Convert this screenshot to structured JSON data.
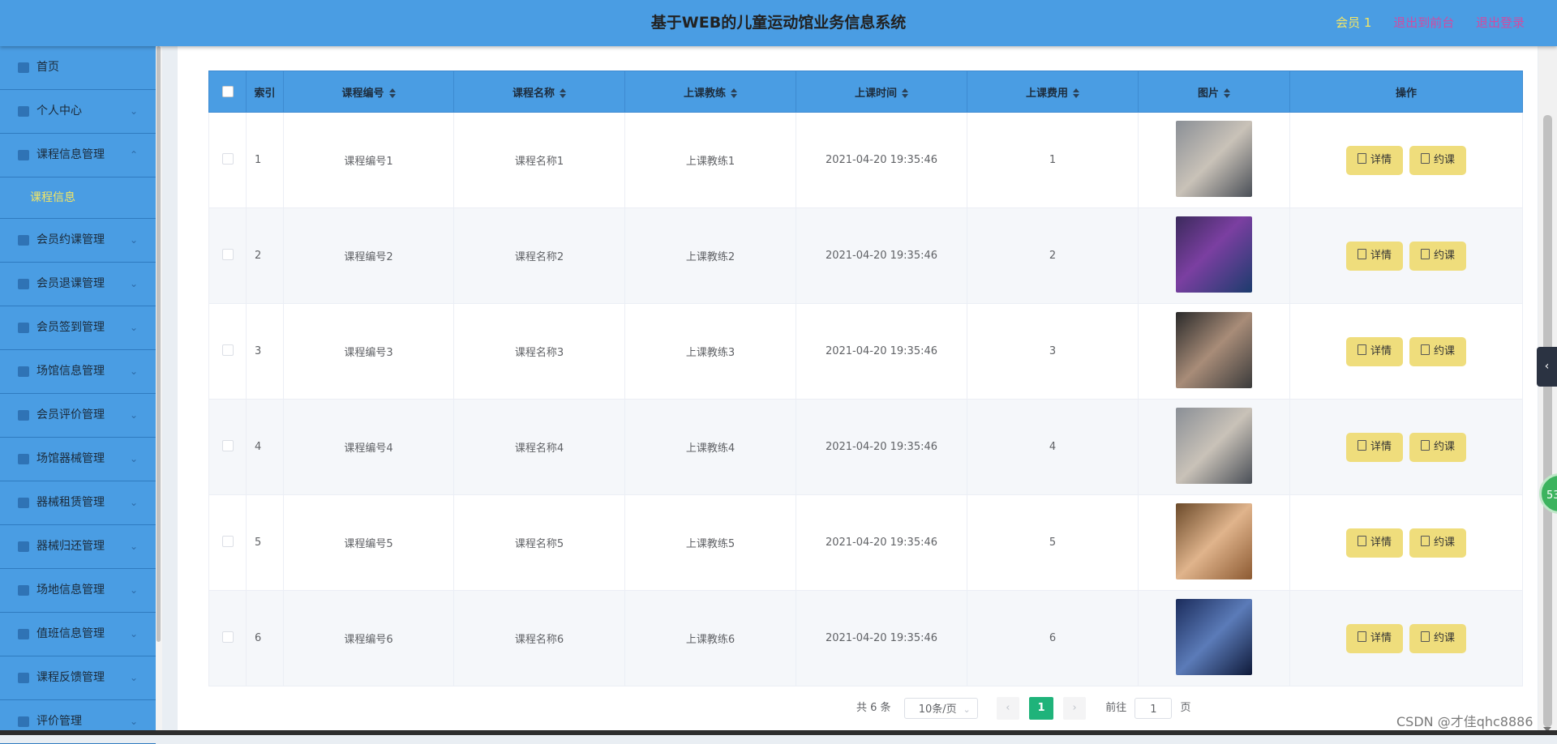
{
  "header": {
    "title": "基于WEB的儿童运动馆业务信息系统",
    "member": "会员 1",
    "back_front": "退出到前台",
    "logout": "退出登录"
  },
  "sidebar": {
    "items": [
      {
        "label": "首页",
        "icon": "home-icon"
      },
      {
        "label": "个人中心",
        "icon": "user-icon"
      },
      {
        "label": "课程信息管理",
        "icon": "course-icon",
        "expanded": true,
        "sub": "课程信息"
      },
      {
        "label": "会员约课管理",
        "icon": "booking-icon"
      },
      {
        "label": "会员退课管理",
        "icon": "flag-icon"
      },
      {
        "label": "会员签到管理",
        "icon": "checkin-icon"
      },
      {
        "label": "场馆信息管理",
        "icon": "venue-icon"
      },
      {
        "label": "会员评价管理",
        "icon": "review-icon"
      },
      {
        "label": "场馆器械管理",
        "icon": "equipment-icon"
      },
      {
        "label": "器械租赁管理",
        "icon": "rent-icon"
      },
      {
        "label": "器械归还管理",
        "icon": "return-icon"
      },
      {
        "label": "场地信息管理",
        "icon": "field-icon"
      },
      {
        "label": "值班信息管理",
        "icon": "duty-icon"
      },
      {
        "label": "课程反馈管理",
        "icon": "feedback-icon"
      },
      {
        "label": "评价管理",
        "icon": "rating-icon"
      }
    ]
  },
  "table": {
    "headers": [
      "索引",
      "课程编号",
      "课程名称",
      "上课教练",
      "上课时间",
      "上课费用",
      "图片",
      "操作"
    ],
    "rows": [
      {
        "idx": "1",
        "code": "课程编号1",
        "name": "课程名称1",
        "coach": "上课教练1",
        "time": "2021-04-20 19:35:46",
        "fee": "1"
      },
      {
        "idx": "2",
        "code": "课程编号2",
        "name": "课程名称2",
        "coach": "上课教练2",
        "time": "2021-04-20 19:35:46",
        "fee": "2"
      },
      {
        "idx": "3",
        "code": "课程编号3",
        "name": "课程名称3",
        "coach": "上课教练3",
        "time": "2021-04-20 19:35:46",
        "fee": "3"
      },
      {
        "idx": "4",
        "code": "课程编号4",
        "name": "课程名称4",
        "coach": "上课教练4",
        "time": "2021-04-20 19:35:46",
        "fee": "4"
      },
      {
        "idx": "5",
        "code": "课程编号5",
        "name": "课程名称5",
        "coach": "上课教练5",
        "time": "2021-04-20 19:35:46",
        "fee": "5"
      },
      {
        "idx": "6",
        "code": "课程编号6",
        "name": "课程名称6",
        "coach": "上课教练6",
        "time": "2021-04-20 19:35:46",
        "fee": "6"
      }
    ],
    "detail_label": "详情",
    "book_label": "约课"
  },
  "pagination": {
    "total": "共 6 条",
    "page_size": "10条/页",
    "current": "1",
    "goto_prefix": "前往",
    "goto_value": "1",
    "goto_suffix": "页"
  },
  "overlay": {
    "float_count": "53",
    "watermark": "CSDN @才佳qhc8886"
  },
  "colors": {
    "header_bg": "#4a9de3",
    "accent_yellow": "#f5e663",
    "link_pink": "#d04ba2",
    "button_yellow": "#efdd7c",
    "pager_active": "#1fb37a"
  }
}
